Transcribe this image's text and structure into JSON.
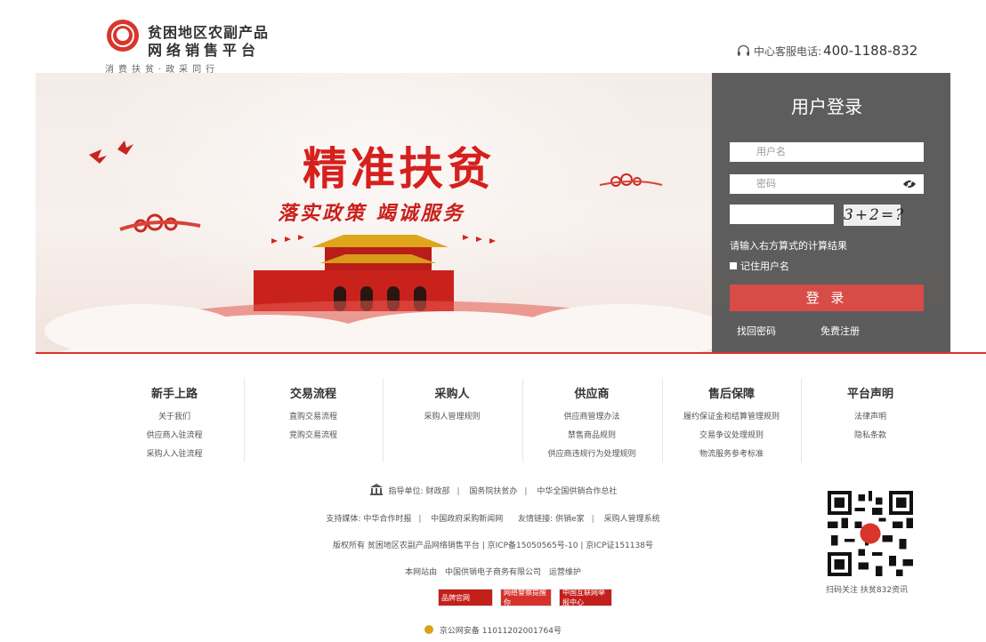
{
  "header": {
    "logo_line1": "贫困地区农副产品",
    "logo_line2": "网络销售平台",
    "logo_tagline": "消费扶贫·政采同行",
    "hotline_label": "中心客服电话:",
    "hotline_number": "400-1188-832"
  },
  "banner": {
    "slogan_main": "精准扶贫",
    "slogan_sub": "落实政策 竭诚服务"
  },
  "login": {
    "title": "用户登录",
    "username_placeholder": "用户名",
    "password_placeholder": "密码",
    "captcha_text": "3+2=?",
    "captcha_hint": "请输入右方算式的计算结果",
    "remember_label": "记住用户名",
    "submit_label": "登 录",
    "forgot_label": "找回密码",
    "register_label": "免费注册"
  },
  "footer_nav": [
    {
      "title": "新手上路",
      "items": [
        "关于我们",
        "供应商入驻流程",
        "采购人入驻流程"
      ]
    },
    {
      "title": "交易流程",
      "items": [
        "直购交易流程",
        "竞购交易流程"
      ]
    },
    {
      "title": "采购人",
      "items": [
        "采购人管理规则"
      ]
    },
    {
      "title": "供应商",
      "items": [
        "供应商管理办法",
        "禁售商品规则",
        "供应商违规行为处理规则"
      ]
    },
    {
      "title": "售后保障",
      "items": [
        "履约保证金和结算管理规则",
        "交易争议处理规则",
        "物流服务参考标准"
      ]
    },
    {
      "title": "平台声明",
      "items": [
        "法律声明",
        "隐私条款"
      ]
    }
  ],
  "footer": {
    "guide_label": "指导单位:",
    "guide_units": [
      "财政部",
      "国务院扶贫办",
      "中华全国供销合作总社"
    ],
    "media_label": "支持媒体:",
    "media": [
      "中华合作时报",
      "中国政府采购新闻网"
    ],
    "friend_label": "友情链接:",
    "friends": [
      "供销e家",
      "采购人管理系统"
    ],
    "copyright": "版权所有 贫困地区农副产品网络销售平台 | 京ICP备15050565号-10 | 京ICP证151138号",
    "operator_prefix": "本网站由",
    "operator_name": "中国供销电子商务有限公司",
    "operator_suffix": "运营维护",
    "qr_caption": "扫码关注 扶贫832资讯",
    "badges": [
      "品牌官网",
      "网络警察提醒你",
      "中国互联网举报中心"
    ],
    "police_record": "京公网安备 11011202001764号"
  },
  "colors": {
    "accent_red": "#d9342a",
    "login_panel": "#505050",
    "login_button": "#d84c47"
  }
}
